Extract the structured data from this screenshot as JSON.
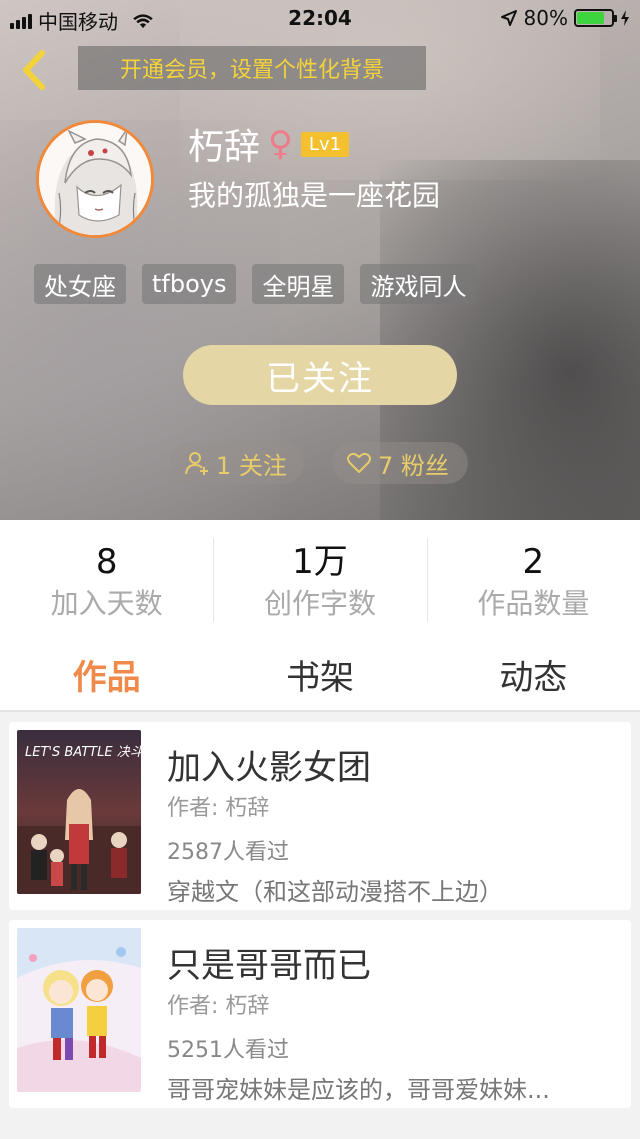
{
  "status_bar": {
    "carrier": "中国移动",
    "time": "22:04",
    "battery_percent": "80%",
    "battery_level": 0.8,
    "battery_color": "#3dd43d"
  },
  "nav": {
    "back_icon": "chevron-left-icon",
    "member_banner": "开通会员，设置个性化背景"
  },
  "profile": {
    "username": "朽辞",
    "gender_icon": "female-icon",
    "gender_symbol": "♀",
    "level": "Lv1",
    "signature": "我的孤独是一座花园",
    "tags": [
      "处女座",
      "tfboys",
      "全明星",
      "游戏同人"
    ],
    "follow_button": "已关注",
    "following_label": "1 关注",
    "fans_label": "7 粉丝"
  },
  "stats": [
    {
      "value": "8",
      "label": "加入天数"
    },
    {
      "value": "1万",
      "label": "创作字数"
    },
    {
      "value": "2",
      "label": "作品数量"
    }
  ],
  "tabs": [
    {
      "label": "作品",
      "active": true
    },
    {
      "label": "书架",
      "active": false
    },
    {
      "label": "动态",
      "active": false
    }
  ],
  "works": [
    {
      "title": "加入火影女团",
      "author": "作者: 朽辞",
      "views": "2587人看过",
      "description": "穿越文（和这部动漫搭不上边）",
      "cover_text": "LET'S BATTLE 决斗吧!!"
    },
    {
      "title": "只是哥哥而已",
      "author": "作者: 朽辞",
      "views": "5251人看过",
      "description": "哥哥宠妹妹是应该的，哥哥爱妹妹...",
      "cover_text": ""
    }
  ],
  "colors": {
    "accent": "#f08a4a",
    "member_text": "#f4d33a",
    "level_badge": "#f4c030",
    "follow_button": "#e5d6a6"
  }
}
